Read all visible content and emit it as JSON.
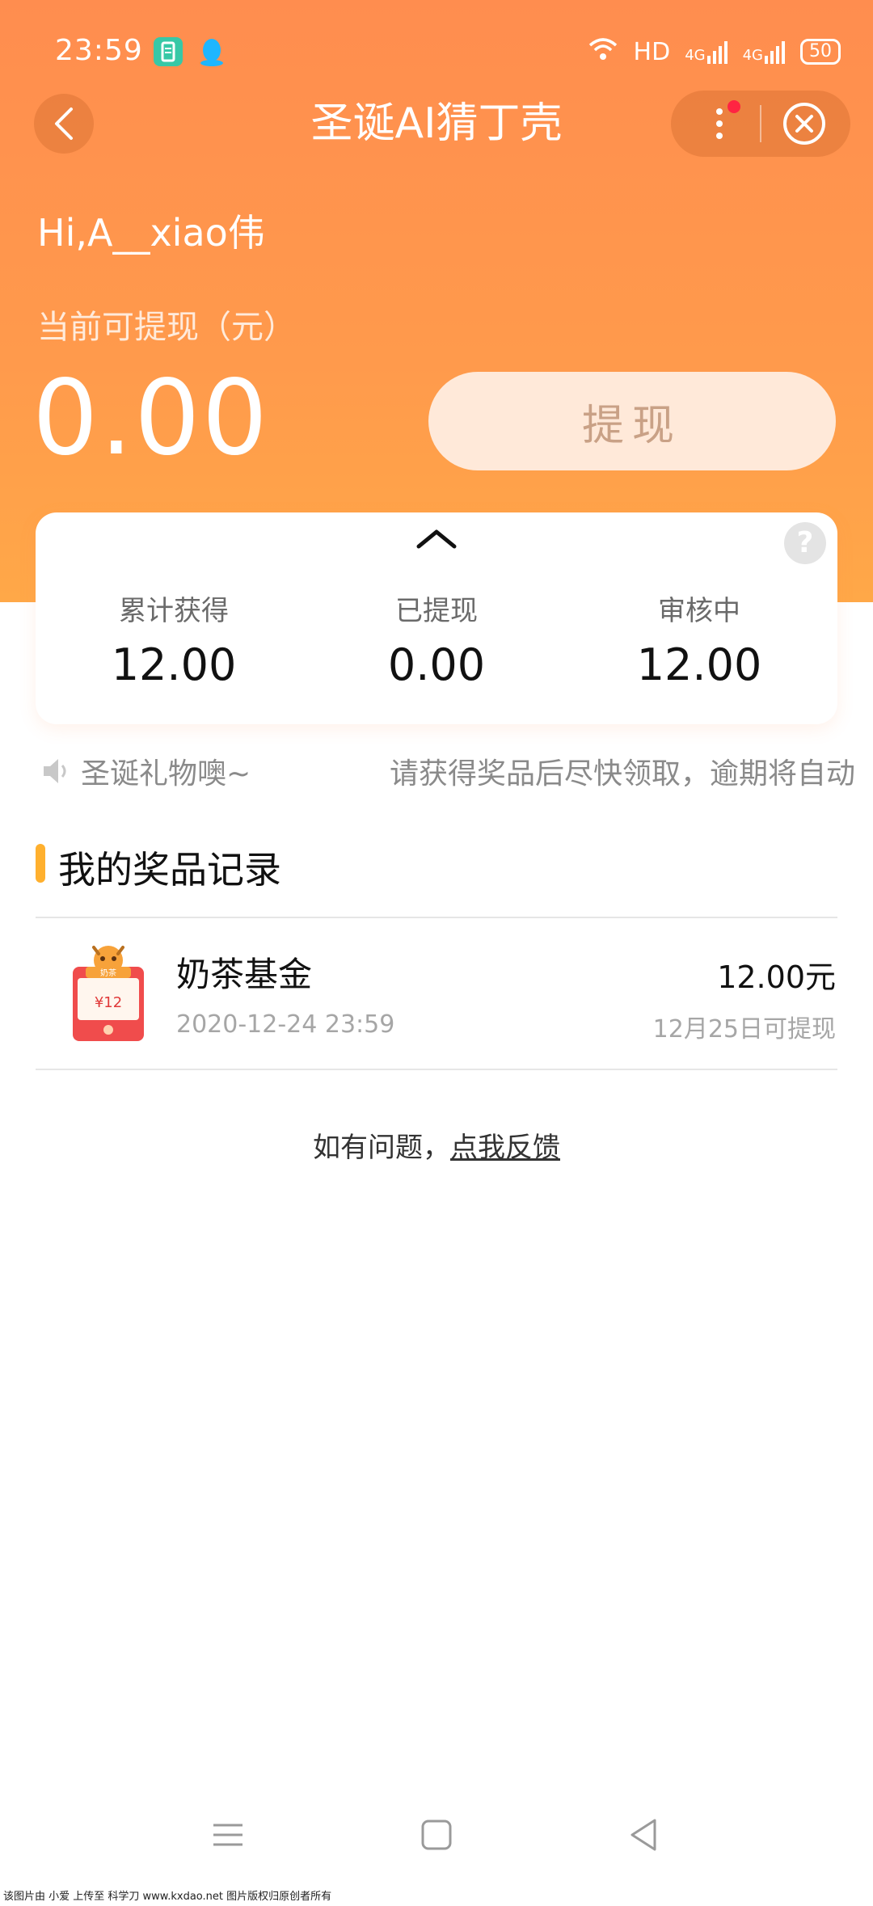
{
  "status_bar": {
    "time": "23:59",
    "network_label": "HD",
    "signal_1": "4G",
    "signal_2": "4G",
    "battery": "50"
  },
  "nav": {
    "title": "圣诞AI猜丁壳"
  },
  "account": {
    "greeting": "Hi,A__xiao伟",
    "balance_label": "当前可提现（元）",
    "balance_value": "0.00",
    "withdraw_label": "提现"
  },
  "stats": [
    {
      "label": "累计获得",
      "value": "12.00"
    },
    {
      "label": "已提现",
      "value": "0.00"
    },
    {
      "label": "审核中",
      "value": "12.00"
    }
  ],
  "marquee": {
    "text_1": "圣诞礼物噢~",
    "text_2": "请获得奖品后尽快领取，逾期将自动"
  },
  "section": {
    "title": "我的奖品记录"
  },
  "records": [
    {
      "name": "奶茶基金",
      "date": "2020-12-24 23:59",
      "amount": "12.00元",
      "note": "12月25日可提现",
      "badge_amount": "¥12",
      "badge_top": "奶茶"
    }
  ],
  "feedback": {
    "prefix": "如有问题，",
    "link": "点我反馈"
  },
  "footer": {
    "text": "该图片由 小爱 上传至 科学刀 www.kxdao.net 图片版权归原创者所有"
  },
  "colors": {
    "header_top": "#ff8d4f",
    "header_bottom": "#ffa848",
    "accent_bar": "#ffb02e",
    "withdraw_bg": "#ffe9d9",
    "red_dot": "#ff2442"
  }
}
